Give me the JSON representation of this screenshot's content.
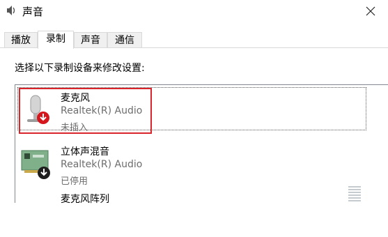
{
  "window": {
    "title": "声音",
    "title_icon": "speaker-icon",
    "close_icon": "close-icon"
  },
  "tabs": [
    {
      "label": "播放",
      "active": false
    },
    {
      "label": "录制",
      "active": true
    },
    {
      "label": "声音",
      "active": false
    },
    {
      "label": "通信",
      "active": false
    }
  ],
  "instruction": "选择以下录制设备来修改设置:",
  "devices": [
    {
      "name": "麦克风",
      "driver": "Realtek(R) Audio",
      "status": "未插入",
      "icon": "microphone-icon",
      "badge": "red-down-arrow-badge",
      "selected": true
    },
    {
      "name": "立体声混音",
      "driver": "Realtek(R) Audio",
      "status": "已停用",
      "icon": "sound-card-icon",
      "badge": "black-down-arrow-badge",
      "selected": false
    },
    {
      "name": "麦克风阵列",
      "icon": "level-meter-icon"
    }
  ],
  "colors": {
    "highlight_border": "#d9242b",
    "disabled_text": "#6d6d6d"
  }
}
